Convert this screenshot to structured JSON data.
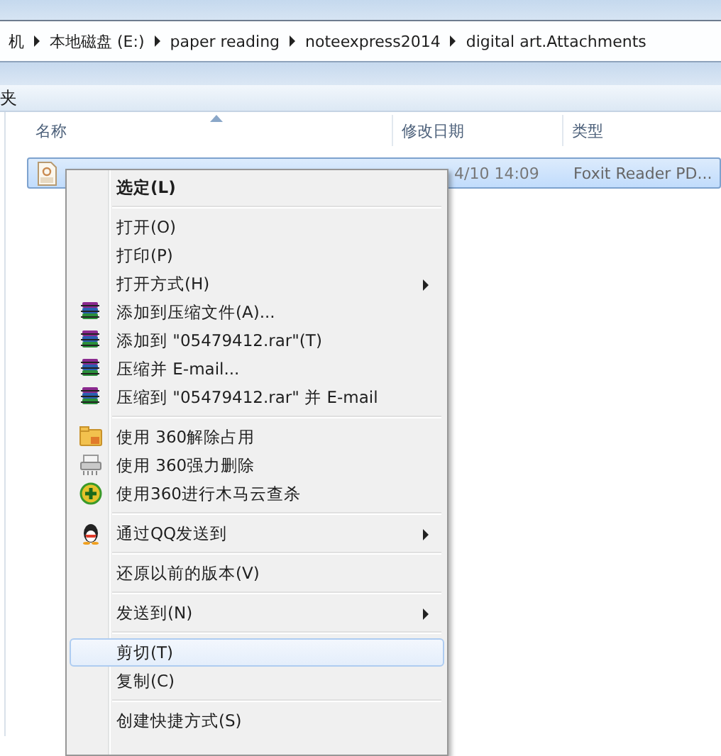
{
  "breadcrumb": [
    "机",
    "本地磁盘 (E:)",
    "paper reading",
    "noteexpress2014",
    "digital art.Attachments"
  ],
  "toolbar": {
    "label": "夹"
  },
  "columns": [
    {
      "label": "名称",
      "sorted": true
    },
    {
      "label": "修改日期",
      "sorted": false
    },
    {
      "label": "类型",
      "sorted": false
    }
  ],
  "files": [
    {
      "date": "4/10 14:09",
      "type": "Foxit Reader PD...",
      "selected": true
    }
  ],
  "context_menu": [
    {
      "kind": "item",
      "label": "选定(L)",
      "bold": true,
      "submenu": false,
      "selected": false
    },
    {
      "kind": "separator"
    },
    {
      "kind": "item",
      "label": "打开(O)",
      "bold": false,
      "submenu": false,
      "selected": false
    },
    {
      "kind": "item",
      "label": "打印(P)",
      "bold": false,
      "submenu": false,
      "selected": false
    },
    {
      "kind": "item",
      "label": "打开方式(H)",
      "bold": false,
      "submenu": true,
      "selected": false
    },
    {
      "kind": "archive",
      "label": "添加到压缩文件(A)...",
      "bold": false,
      "submenu": false,
      "selected": false
    },
    {
      "kind": "archive",
      "label": "添加到 \"05479412.rar\"(T)",
      "bold": false,
      "submenu": false,
      "selected": false
    },
    {
      "kind": "archive",
      "label": "压缩并 E-mail...",
      "bold": false,
      "submenu": false,
      "selected": false
    },
    {
      "kind": "archive",
      "label": "压缩到 \"05479412.rar\" 并 E-mail",
      "bold": false,
      "submenu": false,
      "selected": false
    },
    {
      "kind": "separator"
    },
    {
      "kind": "unlock",
      "label": "使用 360解除占用",
      "bold": false,
      "submenu": false,
      "selected": false
    },
    {
      "kind": "shred",
      "label": "使用 360强力删除",
      "bold": false,
      "submenu": false,
      "selected": false
    },
    {
      "kind": "scan",
      "label": "使用360进行木马云查杀",
      "bold": false,
      "submenu": false,
      "selected": false
    },
    {
      "kind": "separator"
    },
    {
      "kind": "qq",
      "label": "通过QQ发送到",
      "bold": false,
      "submenu": true,
      "selected": false
    },
    {
      "kind": "separator"
    },
    {
      "kind": "item",
      "label": "还原以前的版本(V)",
      "bold": false,
      "submenu": false,
      "selected": false
    },
    {
      "kind": "separator"
    },
    {
      "kind": "item",
      "label": "发送到(N)",
      "bold": false,
      "submenu": true,
      "selected": false
    },
    {
      "kind": "separator"
    },
    {
      "kind": "item",
      "label": "剪切(T)",
      "bold": false,
      "submenu": false,
      "selected": true
    },
    {
      "kind": "item",
      "label": "复制(C)",
      "bold": false,
      "submenu": false,
      "selected": false
    },
    {
      "kind": "separator"
    },
    {
      "kind": "item",
      "label": "创建快捷方式(S)",
      "bold": false,
      "submenu": false,
      "selected": false
    }
  ]
}
